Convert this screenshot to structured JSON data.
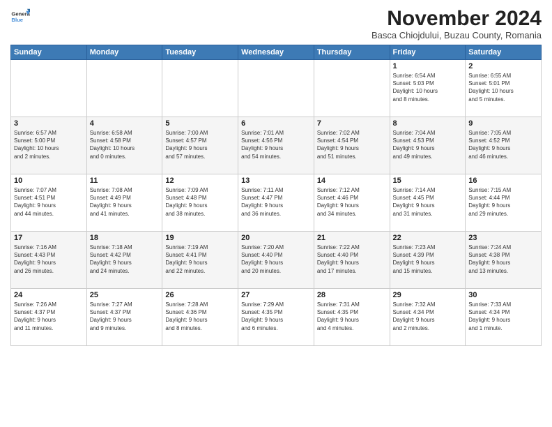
{
  "logo": {
    "general": "General",
    "blue": "Blue"
  },
  "header": {
    "title": "November 2024",
    "subtitle": "Basca Chiojdului, Buzau County, Romania"
  },
  "weekdays": [
    "Sunday",
    "Monday",
    "Tuesday",
    "Wednesday",
    "Thursday",
    "Friday",
    "Saturday"
  ],
  "weeks": [
    [
      {
        "day": "",
        "info": ""
      },
      {
        "day": "",
        "info": ""
      },
      {
        "day": "",
        "info": ""
      },
      {
        "day": "",
        "info": ""
      },
      {
        "day": "",
        "info": ""
      },
      {
        "day": "1",
        "info": "Sunrise: 6:54 AM\nSunset: 5:03 PM\nDaylight: 10 hours\nand 8 minutes."
      },
      {
        "day": "2",
        "info": "Sunrise: 6:55 AM\nSunset: 5:01 PM\nDaylight: 10 hours\nand 5 minutes."
      }
    ],
    [
      {
        "day": "3",
        "info": "Sunrise: 6:57 AM\nSunset: 5:00 PM\nDaylight: 10 hours\nand 2 minutes."
      },
      {
        "day": "4",
        "info": "Sunrise: 6:58 AM\nSunset: 4:58 PM\nDaylight: 10 hours\nand 0 minutes."
      },
      {
        "day": "5",
        "info": "Sunrise: 7:00 AM\nSunset: 4:57 PM\nDaylight: 9 hours\nand 57 minutes."
      },
      {
        "day": "6",
        "info": "Sunrise: 7:01 AM\nSunset: 4:56 PM\nDaylight: 9 hours\nand 54 minutes."
      },
      {
        "day": "7",
        "info": "Sunrise: 7:02 AM\nSunset: 4:54 PM\nDaylight: 9 hours\nand 51 minutes."
      },
      {
        "day": "8",
        "info": "Sunrise: 7:04 AM\nSunset: 4:53 PM\nDaylight: 9 hours\nand 49 minutes."
      },
      {
        "day": "9",
        "info": "Sunrise: 7:05 AM\nSunset: 4:52 PM\nDaylight: 9 hours\nand 46 minutes."
      }
    ],
    [
      {
        "day": "10",
        "info": "Sunrise: 7:07 AM\nSunset: 4:51 PM\nDaylight: 9 hours\nand 44 minutes."
      },
      {
        "day": "11",
        "info": "Sunrise: 7:08 AM\nSunset: 4:49 PM\nDaylight: 9 hours\nand 41 minutes."
      },
      {
        "day": "12",
        "info": "Sunrise: 7:09 AM\nSunset: 4:48 PM\nDaylight: 9 hours\nand 38 minutes."
      },
      {
        "day": "13",
        "info": "Sunrise: 7:11 AM\nSunset: 4:47 PM\nDaylight: 9 hours\nand 36 minutes."
      },
      {
        "day": "14",
        "info": "Sunrise: 7:12 AM\nSunset: 4:46 PM\nDaylight: 9 hours\nand 34 minutes."
      },
      {
        "day": "15",
        "info": "Sunrise: 7:14 AM\nSunset: 4:45 PM\nDaylight: 9 hours\nand 31 minutes."
      },
      {
        "day": "16",
        "info": "Sunrise: 7:15 AM\nSunset: 4:44 PM\nDaylight: 9 hours\nand 29 minutes."
      }
    ],
    [
      {
        "day": "17",
        "info": "Sunrise: 7:16 AM\nSunset: 4:43 PM\nDaylight: 9 hours\nand 26 minutes."
      },
      {
        "day": "18",
        "info": "Sunrise: 7:18 AM\nSunset: 4:42 PM\nDaylight: 9 hours\nand 24 minutes."
      },
      {
        "day": "19",
        "info": "Sunrise: 7:19 AM\nSunset: 4:41 PM\nDaylight: 9 hours\nand 22 minutes."
      },
      {
        "day": "20",
        "info": "Sunrise: 7:20 AM\nSunset: 4:40 PM\nDaylight: 9 hours\nand 20 minutes."
      },
      {
        "day": "21",
        "info": "Sunrise: 7:22 AM\nSunset: 4:40 PM\nDaylight: 9 hours\nand 17 minutes."
      },
      {
        "day": "22",
        "info": "Sunrise: 7:23 AM\nSunset: 4:39 PM\nDaylight: 9 hours\nand 15 minutes."
      },
      {
        "day": "23",
        "info": "Sunrise: 7:24 AM\nSunset: 4:38 PM\nDaylight: 9 hours\nand 13 minutes."
      }
    ],
    [
      {
        "day": "24",
        "info": "Sunrise: 7:26 AM\nSunset: 4:37 PM\nDaylight: 9 hours\nand 11 minutes."
      },
      {
        "day": "25",
        "info": "Sunrise: 7:27 AM\nSunset: 4:37 PM\nDaylight: 9 hours\nand 9 minutes."
      },
      {
        "day": "26",
        "info": "Sunrise: 7:28 AM\nSunset: 4:36 PM\nDaylight: 9 hours\nand 8 minutes."
      },
      {
        "day": "27",
        "info": "Sunrise: 7:29 AM\nSunset: 4:35 PM\nDaylight: 9 hours\nand 6 minutes."
      },
      {
        "day": "28",
        "info": "Sunrise: 7:31 AM\nSunset: 4:35 PM\nDaylight: 9 hours\nand 4 minutes."
      },
      {
        "day": "29",
        "info": "Sunrise: 7:32 AM\nSunset: 4:34 PM\nDaylight: 9 hours\nand 2 minutes."
      },
      {
        "day": "30",
        "info": "Sunrise: 7:33 AM\nSunset: 4:34 PM\nDaylight: 9 hours\nand 1 minute."
      }
    ]
  ]
}
